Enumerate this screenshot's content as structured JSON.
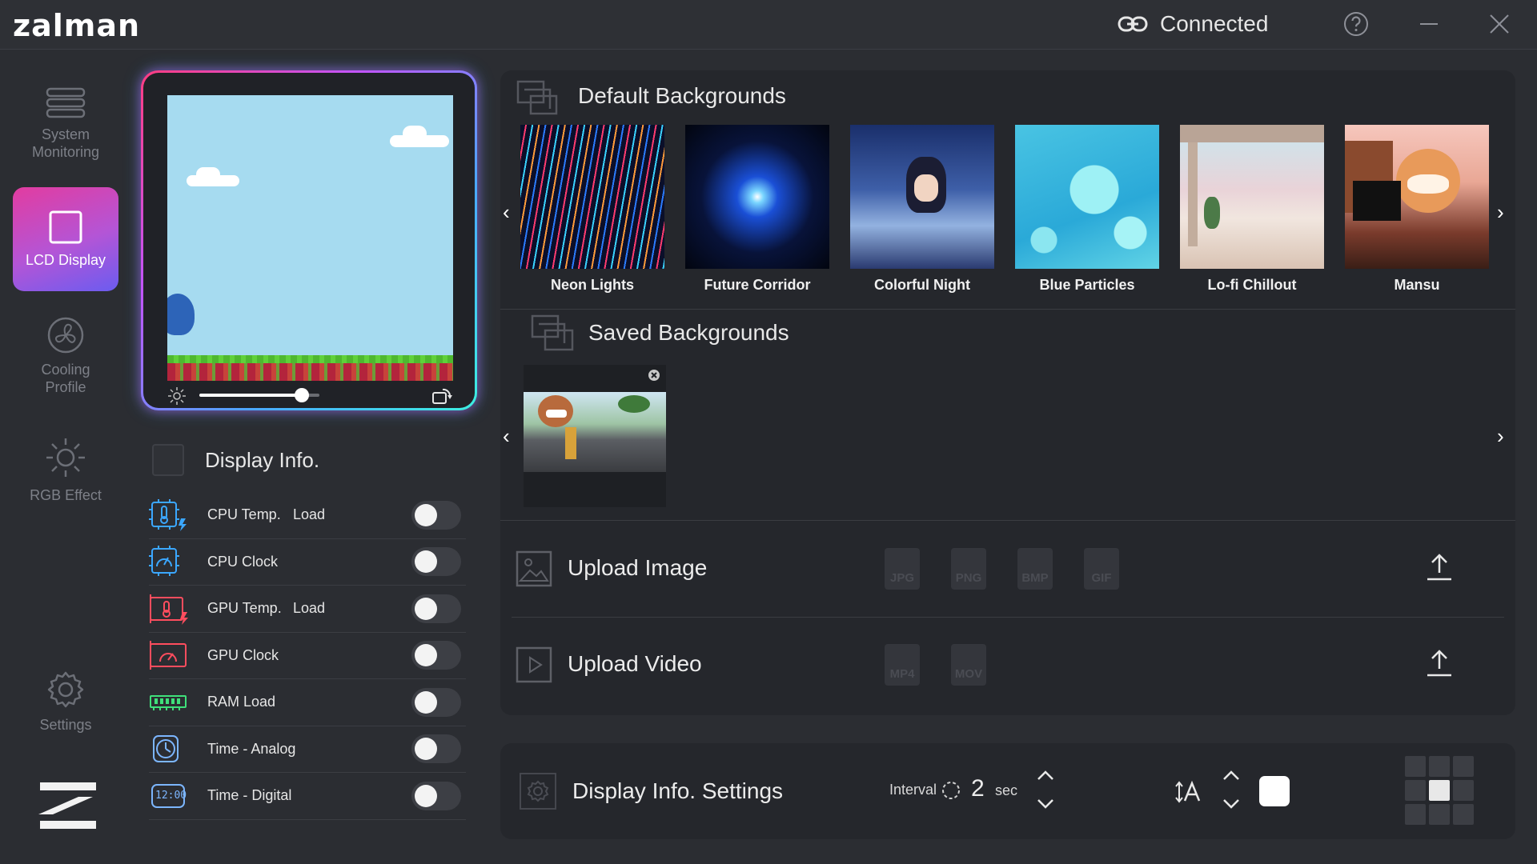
{
  "app": {
    "logo": "zalman",
    "connection_status": "Connected"
  },
  "sidebar": {
    "items": [
      {
        "label": "System\nMonitoring",
        "icon": "system-monitoring-icon",
        "active": false
      },
      {
        "label": "LCD Display",
        "icon": "lcd-display-icon",
        "active": true
      },
      {
        "label": "Cooling\nProfile",
        "icon": "fan-icon",
        "active": false
      },
      {
        "label": "RGB Effect",
        "icon": "sun-icon",
        "active": false
      },
      {
        "label": "Settings",
        "icon": "gear-icon",
        "active": false
      }
    ]
  },
  "preview": {
    "brightness": 0.85
  },
  "display_info": {
    "title": "Display Info.",
    "rows": [
      {
        "label": "CPU Temp.",
        "sub": "Load",
        "icon": "cpu-temp-icon",
        "enabled": false
      },
      {
        "label": "CPU Clock",
        "sub": "",
        "icon": "cpu-clock-icon",
        "enabled": false
      },
      {
        "label": "GPU Temp.",
        "sub": "Load",
        "icon": "gpu-temp-icon",
        "enabled": false
      },
      {
        "label": "GPU Clock",
        "sub": "",
        "icon": "gpu-clock-icon",
        "enabled": false
      },
      {
        "label": "RAM Load",
        "sub": "",
        "icon": "ram-icon",
        "enabled": false
      },
      {
        "label": "Time - Analog",
        "sub": "",
        "icon": "clock-analog-icon",
        "enabled": false
      },
      {
        "label": "Time - Digital",
        "sub": "",
        "icon": "clock-digital-icon",
        "enabled": false,
        "icon_text": "12:00"
      }
    ]
  },
  "default_backgrounds": {
    "title": "Default Backgrounds",
    "items": [
      {
        "name": "Neon Lights"
      },
      {
        "name": "Future Corridor"
      },
      {
        "name": "Colorful Night"
      },
      {
        "name": "Blue Particles"
      },
      {
        "name": "Lo-fi Chillout"
      },
      {
        "name": "Mansu"
      }
    ]
  },
  "saved_backgrounds": {
    "title": "Saved Backgrounds",
    "count": 1
  },
  "upload_image": {
    "title": "Upload Image",
    "formats": [
      "JPG",
      "PNG",
      "BMP",
      "GIF"
    ]
  },
  "upload_video": {
    "title": "Upload Video",
    "formats": [
      "MP4",
      "MOV"
    ]
  },
  "display_settings": {
    "title": "Display Info. Settings",
    "interval_label": "Interval",
    "interval_value": "2",
    "interval_unit": "sec",
    "text_color": "#ffffff"
  },
  "colors": {
    "accent_start": "#e23ca0",
    "accent_end": "#6b5cf0",
    "background": "#2b2d32",
    "panel": "#25272c"
  }
}
